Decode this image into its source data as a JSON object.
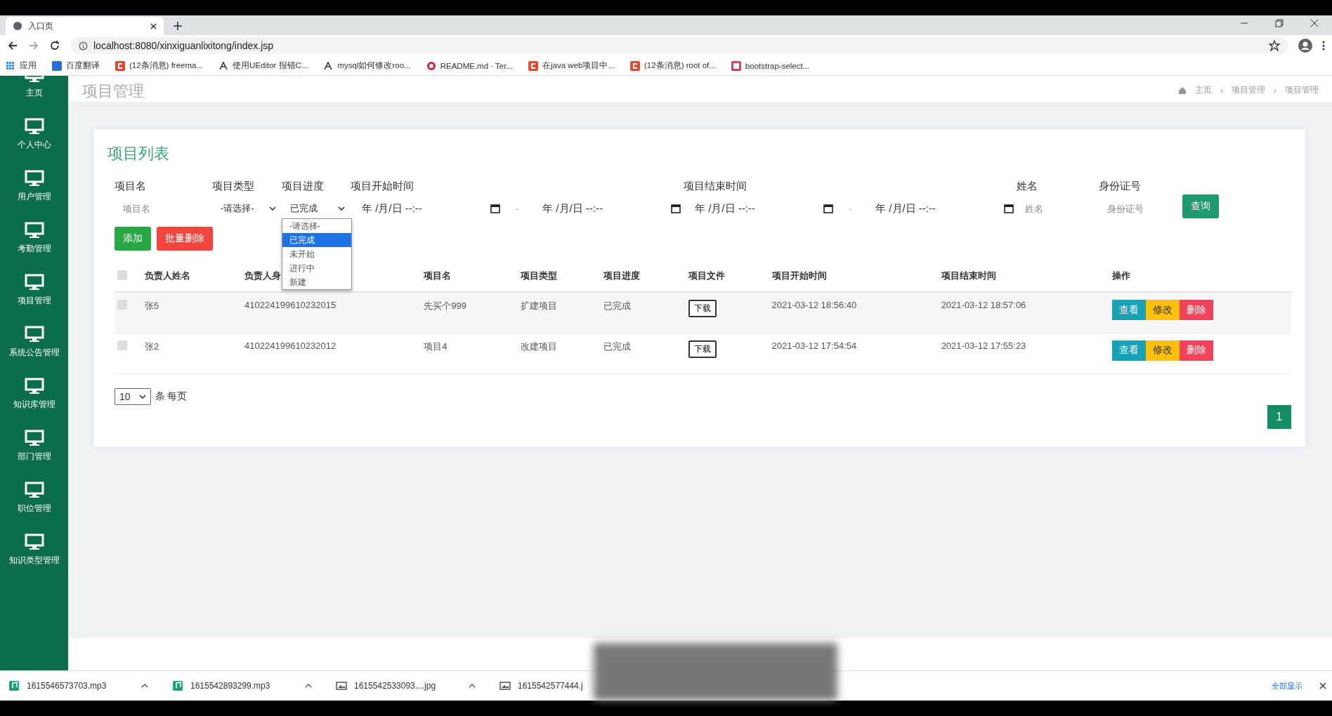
{
  "browser": {
    "tab_title": "入口页",
    "url": "localhost:8080/xinxiguanlixitong/index.jsp",
    "bookmarks": [
      {
        "label": "应用",
        "kind": "apps"
      },
      {
        "label": "百度翻译",
        "kind": "blue"
      },
      {
        "label": "(12条消息) freema...",
        "kind": "red"
      },
      {
        "label": "使用UEditor 报错C...",
        "kind": "link"
      },
      {
        "label": "mysql如何修改roo...",
        "kind": "link"
      },
      {
        "label": "README.md · Ter...",
        "kind": "ring"
      },
      {
        "label": "在java web项目中...",
        "kind": "red"
      },
      {
        "label": "(12条消息) root of...",
        "kind": "red"
      },
      {
        "label": "bootstrap-select...",
        "kind": "pink"
      }
    ]
  },
  "sidebar": {
    "items": [
      {
        "label": "主页"
      },
      {
        "label": "个人中心"
      },
      {
        "label": "用户管理"
      },
      {
        "label": "考勤管理"
      },
      {
        "label": "项目管理"
      },
      {
        "label": "系统公告管理"
      },
      {
        "label": "知识库管理"
      },
      {
        "label": "部门管理"
      },
      {
        "label": "职位管理"
      },
      {
        "label": "知识类型管理"
      }
    ]
  },
  "page": {
    "title": "项目管理",
    "breadcrumb": [
      "主页",
      "项目管理",
      "项目管理"
    ],
    "breadcrumb_separator": "›"
  },
  "card": {
    "title": "项目列表",
    "filters": [
      {
        "kind": "text",
        "label": "项目名",
        "placeholder": "项目名"
      },
      {
        "kind": "select",
        "label": "项目类型",
        "value": "-请选择-",
        "open": false
      },
      {
        "kind": "select",
        "label": "项目进度",
        "value": "已完成",
        "open": true,
        "options": [
          {
            "label": "-请选择-",
            "selected": false
          },
          {
            "label": "已完成",
            "selected": true
          },
          {
            "label": "未开始",
            "selected": false
          },
          {
            "label": "进行中",
            "selected": false
          },
          {
            "label": "新建",
            "selected": false
          }
        ]
      },
      {
        "kind": "daterange",
        "label": "项目开始时间",
        "from": "年 /月/日 --:--",
        "separator": "-",
        "to": "年 /月/日 --:--"
      },
      {
        "kind": "daterange",
        "label": "项目结束时间",
        "from": "年 /月/日 --:--",
        "separator": "-",
        "to": "年 /月/日 --:--"
      },
      {
        "kind": "text",
        "label": "姓名",
        "placeholder": "姓名"
      },
      {
        "kind": "text",
        "label": "身份证号",
        "placeholder": "身份证号"
      }
    ],
    "search_button": "查询",
    "actions": [
      {
        "label": "添加",
        "kind": "add"
      },
      {
        "label": "批量删除",
        "kind": "delete"
      }
    ],
    "table": {
      "header_checked": false,
      "columns": [
        {
          "label": "负责人姓名",
          "kind": "text"
        },
        {
          "label": "负责人身",
          "kind": "text"
        },
        {
          "label": "项目名",
          "kind": "text"
        },
        {
          "label": "项目类型",
          "kind": "text"
        },
        {
          "label": "项目进度",
          "kind": "text"
        },
        {
          "label": "项目文件",
          "kind": "file"
        },
        {
          "label": "项目开始时间",
          "kind": "text"
        },
        {
          "label": "项目结束时间",
          "kind": "text"
        },
        {
          "label": "操作",
          "kind": "actions"
        }
      ],
      "rows": [
        {
          "checked": false,
          "cells": [
            "张5",
            "410224199610232015",
            "先买个999",
            "扩建项目",
            "已完成",
            "下载",
            "2021-03-12 18:56:40",
            "2021-03-12 18:57:06"
          ],
          "actions": [
            {
              "label": "查看",
              "kind": "view"
            },
            {
              "label": "修改",
              "kind": "edit"
            },
            {
              "label": "删除",
              "kind": "delete"
            }
          ]
        },
        {
          "checked": false,
          "cells": [
            "张2",
            "410224199610232012",
            "项目4",
            "改建项目",
            "已完成",
            "下载",
            "2021-03-12 17:54:54",
            "2021-03-12 17:55:23"
          ],
          "actions": [
            {
              "label": "查看",
              "kind": "view"
            },
            {
              "label": "修改",
              "kind": "edit"
            },
            {
              "label": "删除",
              "kind": "delete"
            }
          ]
        }
      ]
    },
    "page_size": {
      "value": "10",
      "suffix": "条 每页"
    },
    "pagination": [
      {
        "label": "1",
        "selected": true
      }
    ]
  },
  "downloads": {
    "items": [
      {
        "name": "1615546573703.mp3",
        "kind": "audio"
      },
      {
        "name": "1615542893299.mp3",
        "kind": "audio"
      },
      {
        "name": "1615542533093....jpg",
        "kind": "image"
      },
      {
        "name": "1615542577444.j",
        "kind": "image"
      }
    ],
    "show_all": "全部显示"
  }
}
